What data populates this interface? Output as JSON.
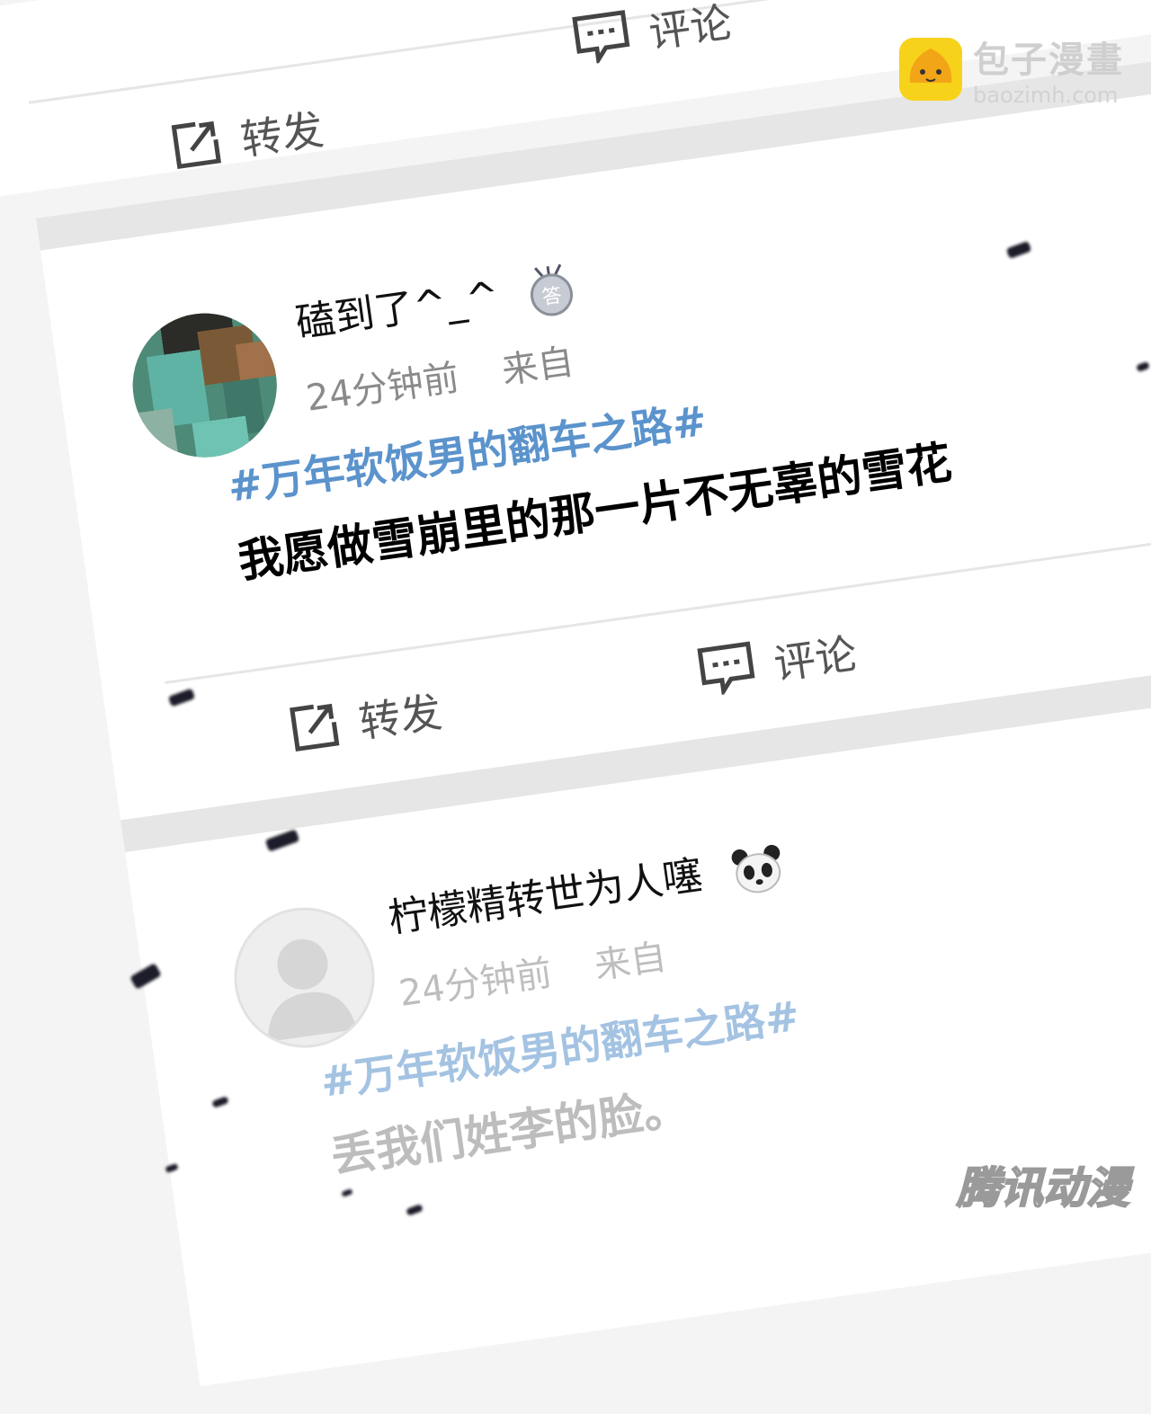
{
  "post_top": {
    "repost_label": "转发",
    "comment_label": "评论"
  },
  "post1": {
    "username": "磕到了^_^",
    "time": "24分钟前",
    "source": "来自",
    "topic": "#万年软饭男的翻车之路#",
    "content": "我愿做雪崩里的那一片不无辜的雪花",
    "repost_label": "转发",
    "comment_label": "评论",
    "badge_icon": "medal-icon"
  },
  "post2": {
    "username": "柠檬精转世为人噻",
    "time": "24分钟前",
    "source": "来自",
    "topic": "#万年软饭男的翻车之路#",
    "content": "丢我们姓李的脸。",
    "badge_icon": "panda-icon"
  },
  "watermark": {
    "name": "包子漫畫",
    "url": "baozimh.com",
    "corner_logo": "腾讯动漫"
  },
  "colors": {
    "topic": "#5b93cc",
    "background": "#f4f4f4",
    "card": "#ffffff"
  }
}
